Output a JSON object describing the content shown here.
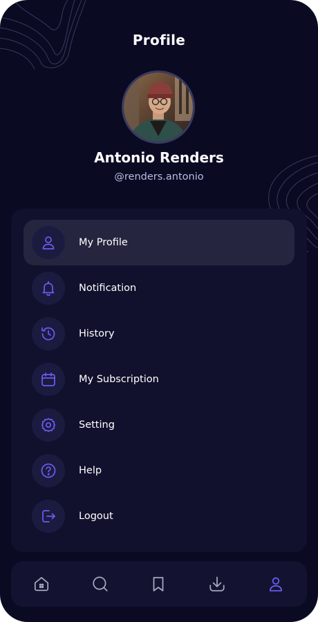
{
  "page": {
    "title": "Profile"
  },
  "user": {
    "name": "Antonio Renders",
    "handle": "@renders.antonio"
  },
  "menu": {
    "items": [
      {
        "label": "My Profile",
        "icon": "user-icon",
        "active": true
      },
      {
        "label": "Notification",
        "icon": "bell-icon",
        "active": false
      },
      {
        "label": "History",
        "icon": "history-icon",
        "active": false
      },
      {
        "label": "My Subscription",
        "icon": "calendar-icon",
        "active": false
      },
      {
        "label": "Setting",
        "icon": "gear-icon",
        "active": false
      },
      {
        "label": "Help",
        "icon": "help-icon",
        "active": false
      },
      {
        "label": "Logout",
        "icon": "logout-icon",
        "active": false
      }
    ]
  },
  "bottom_nav": {
    "items": [
      {
        "icon": "home-icon",
        "active": false
      },
      {
        "icon": "search-icon",
        "active": false
      },
      {
        "icon": "bookmark-icon",
        "active": false
      },
      {
        "icon": "download-icon",
        "active": false
      },
      {
        "icon": "user-icon",
        "active": true
      }
    ]
  },
  "colors": {
    "background": "#0a0a23",
    "card": "#11112e",
    "active_row": "#25253f",
    "icon_circle": "#1b1b40",
    "accent": "#6b5cf0",
    "nav_icon": "#a8a8c0",
    "text_primary": "#ffffff",
    "text_secondary": "#b8bde0"
  }
}
